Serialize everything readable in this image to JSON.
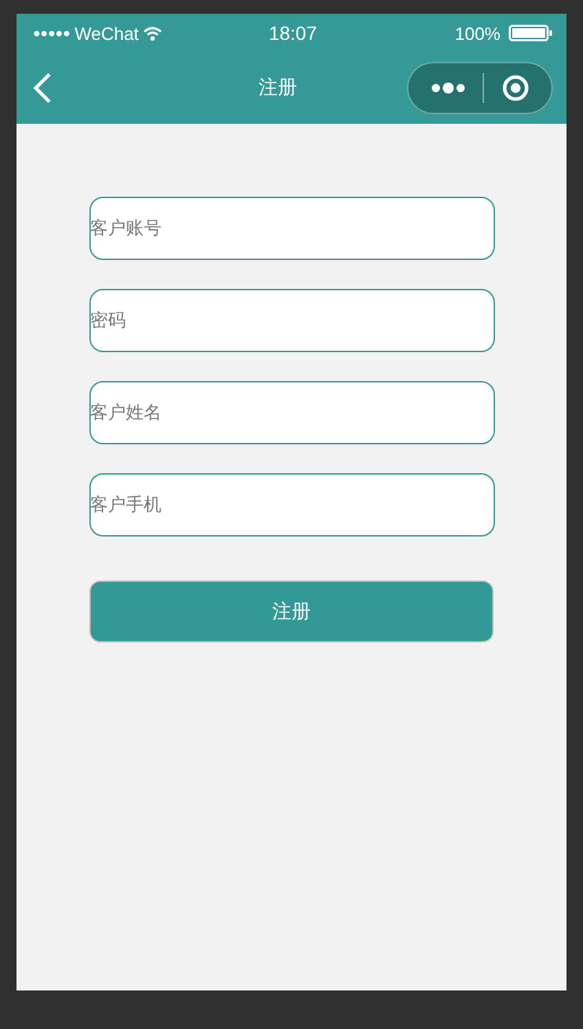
{
  "status_bar": {
    "signal_dots": "●●●●●",
    "carrier": "WeChat",
    "time": "18:07",
    "battery": "100%"
  },
  "nav_bar": {
    "title": "注册"
  },
  "form": {
    "fields": [
      {
        "placeholder": "客户账号"
      },
      {
        "placeholder": "密码"
      },
      {
        "placeholder": "客户姓名"
      },
      {
        "placeholder": "客户手机"
      }
    ],
    "submit": "注册"
  }
}
